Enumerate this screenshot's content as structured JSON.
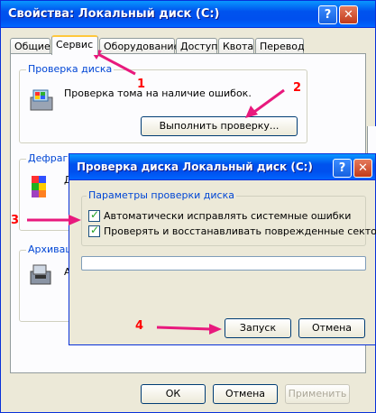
{
  "window": {
    "title": "Свойства: Локальный диск (C:)",
    "help_glyph": "?",
    "close_glyph": "✕",
    "tabs": [
      {
        "label": "Общие"
      },
      {
        "label": "Сервис"
      },
      {
        "label": "Оборудование"
      },
      {
        "label": "Доступ"
      },
      {
        "label": "Квота"
      },
      {
        "label": "Перевод"
      }
    ],
    "active_tab": "Сервис",
    "check_group": {
      "label": "Проверка диска",
      "description": "Проверка тома на наличие ошибок.",
      "button": "Выполнить проверку..."
    },
    "defrag_group": {
      "label": "Дефрагм",
      "text": "Д"
    },
    "backup_group": {
      "label": "Архивац",
      "text": "А"
    },
    "buttons": {
      "ok": "ОК",
      "cancel": "Отмена",
      "apply": "Применить"
    }
  },
  "dialog": {
    "title": "Проверка диска Локальный диск (C:)",
    "help_glyph": "?",
    "close_glyph": "✕",
    "group_label": "Параметры проверки диска",
    "options": [
      {
        "label": "Автоматически исправлять системные ошибки",
        "checked": true
      },
      {
        "label": "Проверять и восстанавливать поврежденные сектора",
        "checked": true
      }
    ],
    "progress": 0,
    "buttons": {
      "start": "Запуск",
      "cancel": "Отмена"
    }
  },
  "annotations": {
    "markers": [
      "1",
      "2",
      "3",
      "4"
    ],
    "color": "#ff0000",
    "arrow_color": "#e8197d"
  },
  "colors": {
    "titlebar": "#0053ee",
    "window_bg": "#ece9d8",
    "group_label": "#0046d5"
  }
}
